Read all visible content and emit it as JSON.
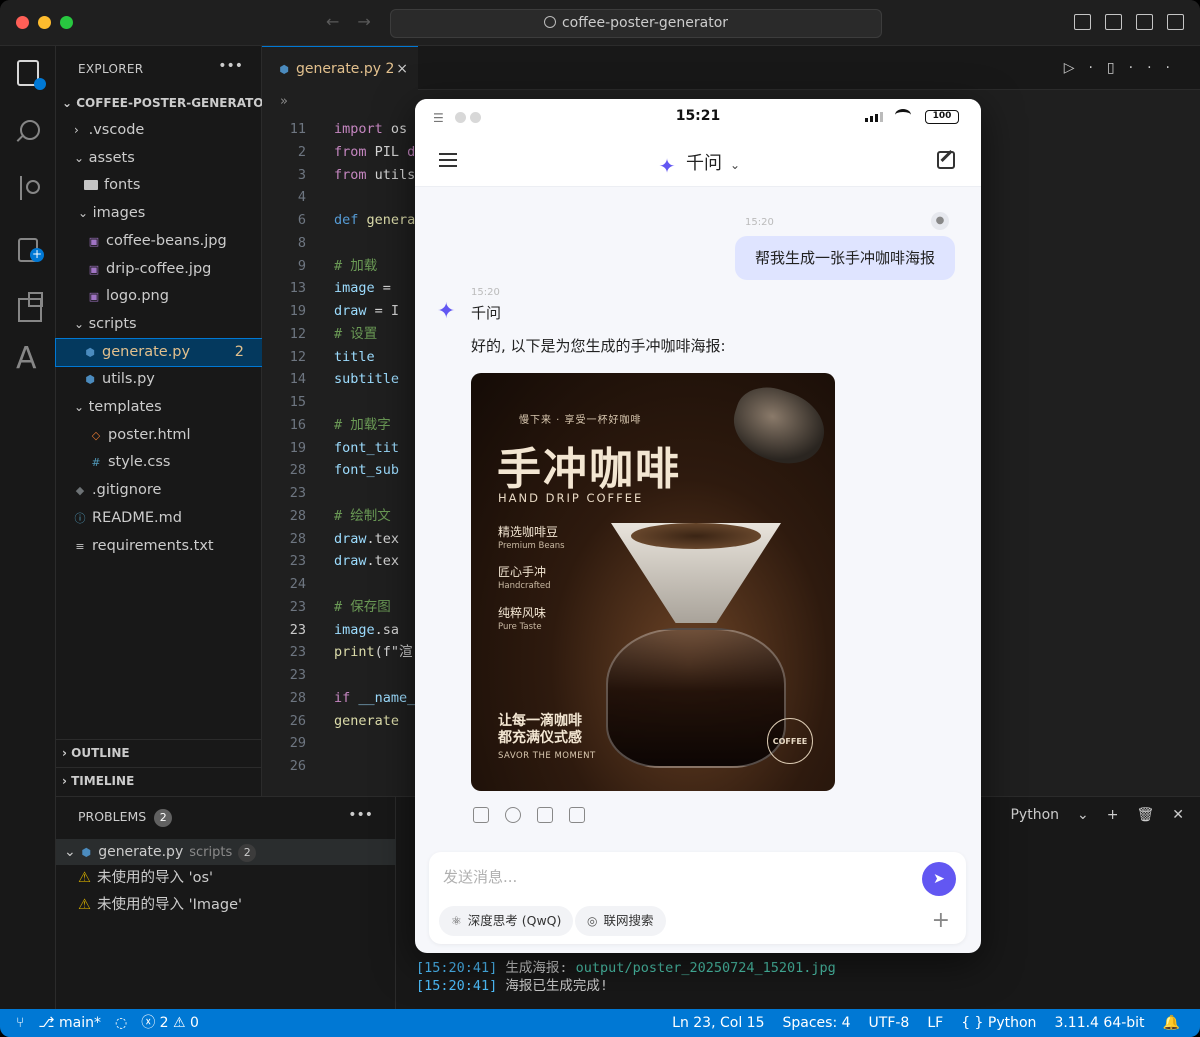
{
  "window": {
    "search_text": "coffee-poster-generator"
  },
  "explorer": {
    "title": "EXPLORER",
    "more": "•••",
    "project": "COFFEE-POSTER-GENERATOR",
    "items": [
      {
        "label": ".vscode",
        "kind": "folder",
        "chev": "›"
      },
      {
        "label": "assets",
        "kind": "folder",
        "chev": "⌄"
      },
      {
        "label": "fonts",
        "kind": "folder-icon"
      },
      {
        "label": "images",
        "kind": "folder",
        "chev": "⌄"
      },
      {
        "label": "coffee-beans.jpg",
        "kind": "image"
      },
      {
        "label": "drip-coffee.jpg",
        "kind": "image"
      },
      {
        "label": "logo.png",
        "kind": "image"
      },
      {
        "label": "scripts",
        "kind": "folder",
        "chev": "⌄"
      },
      {
        "label": "generate.py",
        "kind": "python",
        "badge": "2"
      },
      {
        "label": "utils.py",
        "kind": "python"
      },
      {
        "label": "templates",
        "kind": "folder",
        "chev": "⌄"
      },
      {
        "label": "poster.html",
        "kind": "html"
      },
      {
        "label": "style.css",
        "kind": "css"
      },
      {
        "label": ".gitignore",
        "kind": "git"
      },
      {
        "label": "README.md",
        "kind": "info"
      },
      {
        "label": "requirements.txt",
        "kind": "txt"
      }
    ],
    "outline": "OUTLINE",
    "timeline": "TIMELINE"
  },
  "editor": {
    "tab_label": "generate.py 2",
    "tab_close": "×",
    "breadcrumb": "»",
    "lines": [
      {
        "n": "11",
        "parts": [
          [
            "kw",
            "import "
          ],
          [
            "plain",
            "os"
          ]
        ]
      },
      {
        "n": "2",
        "parts": [
          [
            "kw",
            "from "
          ],
          [
            "plain",
            "PIL "
          ],
          [
            "kw",
            "d"
          ]
        ]
      },
      {
        "n": "3",
        "parts": [
          [
            "kw",
            "from "
          ],
          [
            "plain",
            "utils "
          ],
          [
            "kw",
            "i"
          ]
        ]
      },
      {
        "n": "4",
        "parts": []
      },
      {
        "n": "6",
        "parts": [
          [
            "kw2",
            "def "
          ],
          [
            "fn",
            "generate"
          ]
        ]
      },
      {
        "n": "8",
        "parts": []
      },
      {
        "n": "9",
        "parts": [
          [
            "cm",
            "    # 加载"
          ]
        ]
      },
      {
        "n": "13",
        "parts": [
          [
            "vr",
            "    image"
          ],
          [
            "plain",
            " ="
          ]
        ]
      },
      {
        "n": "19",
        "parts": [
          [
            "vr",
            "    draw"
          ],
          [
            "plain",
            " = I"
          ]
        ]
      },
      {
        "n": "12",
        "parts": [
          [
            "cm",
            "    # 设置"
          ]
        ]
      },
      {
        "n": "12",
        "parts": [
          [
            "vr",
            "    title"
          ]
        ]
      },
      {
        "n": "14",
        "parts": [
          [
            "vr",
            "    subtitle"
          ]
        ]
      },
      {
        "n": "15",
        "parts": []
      },
      {
        "n": "16",
        "parts": [
          [
            "cm",
            "    # 加载字"
          ]
        ]
      },
      {
        "n": "19",
        "parts": [
          [
            "vr",
            "    font_tit"
          ]
        ]
      },
      {
        "n": "28",
        "parts": [
          [
            "vr",
            "    font_sub"
          ]
        ]
      },
      {
        "n": "23",
        "parts": []
      },
      {
        "n": "28",
        "parts": [
          [
            "cm",
            "    # 绘制文"
          ]
        ]
      },
      {
        "n": "28",
        "parts": [
          [
            "vr",
            "    draw"
          ],
          [
            "plain",
            ".tex"
          ]
        ]
      },
      {
        "n": "23",
        "parts": [
          [
            "vr",
            "    draw"
          ],
          [
            "plain",
            ".tex"
          ]
        ]
      },
      {
        "n": "24",
        "parts": []
      },
      {
        "n": "23",
        "parts": [
          [
            "cm",
            "    # 保存图"
          ]
        ]
      },
      {
        "n": "23",
        "parts": [
          [
            "vr",
            "    image"
          ],
          [
            "plain",
            ".sa"
          ]
        ],
        "active": true
      },
      {
        "n": "23",
        "parts": [
          [
            "fn",
            "    print"
          ],
          [
            "plain",
            "(f\"渲"
          ]
        ]
      },
      {
        "n": "23",
        "parts": []
      },
      {
        "n": "28",
        "parts": [
          [
            "kw",
            "if "
          ],
          [
            "vr",
            "__name__"
          ]
        ]
      },
      {
        "n": "26",
        "parts": [
          [
            "fn",
            "    generate"
          ]
        ]
      },
      {
        "n": "29",
        "parts": []
      },
      {
        "n": "26",
        "parts": []
      }
    ]
  },
  "problems": {
    "title": "PROBLEMS",
    "count": "2",
    "more": "•••",
    "file": "generate.py",
    "folder": "scripts",
    "file_count": "2",
    "items": [
      "未使用的导入 'os'",
      "未使用的导入 'Image'"
    ]
  },
  "terminal": {
    "shell": "Python",
    "lines": [
      {
        "time": "[15:20:41]",
        "text": " 生成海报: ",
        "path": "output/poster_20250724_15201.jpg"
      },
      {
        "time": "[15:20:41]",
        "text": " 海报已生成完成!",
        "path": ""
      }
    ]
  },
  "statusbar": {
    "branch": "main*",
    "errors": "2",
    "warnings": "0",
    "position": "Ln 23, Col 15",
    "spaces": "Spaces: 4",
    "encoding": "UTF-8",
    "eol": "LF",
    "language": "Python",
    "interpreter": "3.11.4 64-bit"
  },
  "chat": {
    "status_time": "15:21",
    "battery": "100",
    "app_name": "千问",
    "user_time": "15:20",
    "user_message": "帮我生成一张手冲咖啡海报",
    "bot_time": "15:20",
    "bot_name": "千问",
    "bot_message": "好的, 以下是为您生成的手冲咖啡海报:",
    "poster": {
      "top_line": "慢下来 · 享受一杯好咖啡",
      "title": "手冲咖啡",
      "subtitle": "HAND DRIP COFFEE",
      "features": [
        {
          "zh": "精选咖啡豆",
          "en": "Premium Beans"
        },
        {
          "zh": "匠心手冲",
          "en": "Handcrafted"
        },
        {
          "zh": "纯粹风味",
          "en": "Pure Taste"
        }
      ],
      "bottom_line1": "让每一滴咖啡",
      "bottom_line2": "都充满仪式感",
      "savor": "SAVOR THE MOMENT",
      "seal": "COFFEE"
    },
    "input_placeholder": "发送消息...",
    "chip_deep": "深度思考 (QwQ)",
    "chip_web": "联网搜索"
  },
  "colors": {
    "accent": "#0078d4",
    "qwen": "#6257f2",
    "user_bubble": "#dfe4ff"
  }
}
